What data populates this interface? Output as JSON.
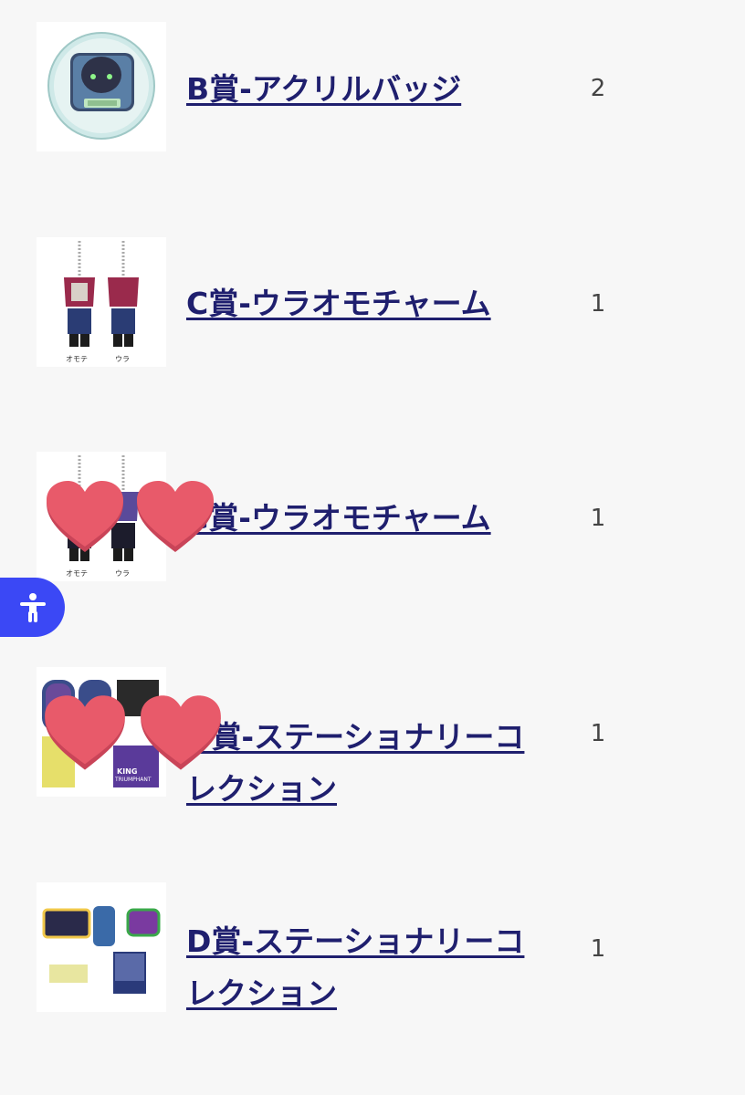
{
  "colors": {
    "page_background": "#f7f7f7",
    "link": "#1f1f6e",
    "quantity": "#444444",
    "accessibility_button": "#3b48f5",
    "heart_sticker": "#e85a6a"
  },
  "accessibility": {
    "icon": "accessibility-person-icon"
  },
  "items": [
    {
      "name": "B賞-アクリルバッジ",
      "quantity": "2",
      "thumbnail": "acrylic-badge-thumbnail"
    },
    {
      "name": "C賞-ウラオモチャーム",
      "quantity": "1",
      "thumbnail": "reversible-charm-thumbnail",
      "captions": [
        "オモテ",
        "ウラ"
      ]
    },
    {
      "name": "C賞-ウラオモチャーム",
      "quantity": "1",
      "thumbnail": "reversible-charm-thumbnail",
      "captions": [
        "オモテ",
        "ウラ"
      ]
    },
    {
      "name": "D賞-ステーショナリーコレクション",
      "quantity": "1",
      "thumbnail": "stationery-collection-thumbnail",
      "thumb_texts": [
        "KING",
        "TRIUMPHANT"
      ]
    },
    {
      "name": "D賞-ステーショナリーコレクション",
      "quantity": "1",
      "thumbnail": "stationery-collection-thumbnail"
    }
  ],
  "overlays": {
    "stickers": "heart-sticker-icon"
  }
}
